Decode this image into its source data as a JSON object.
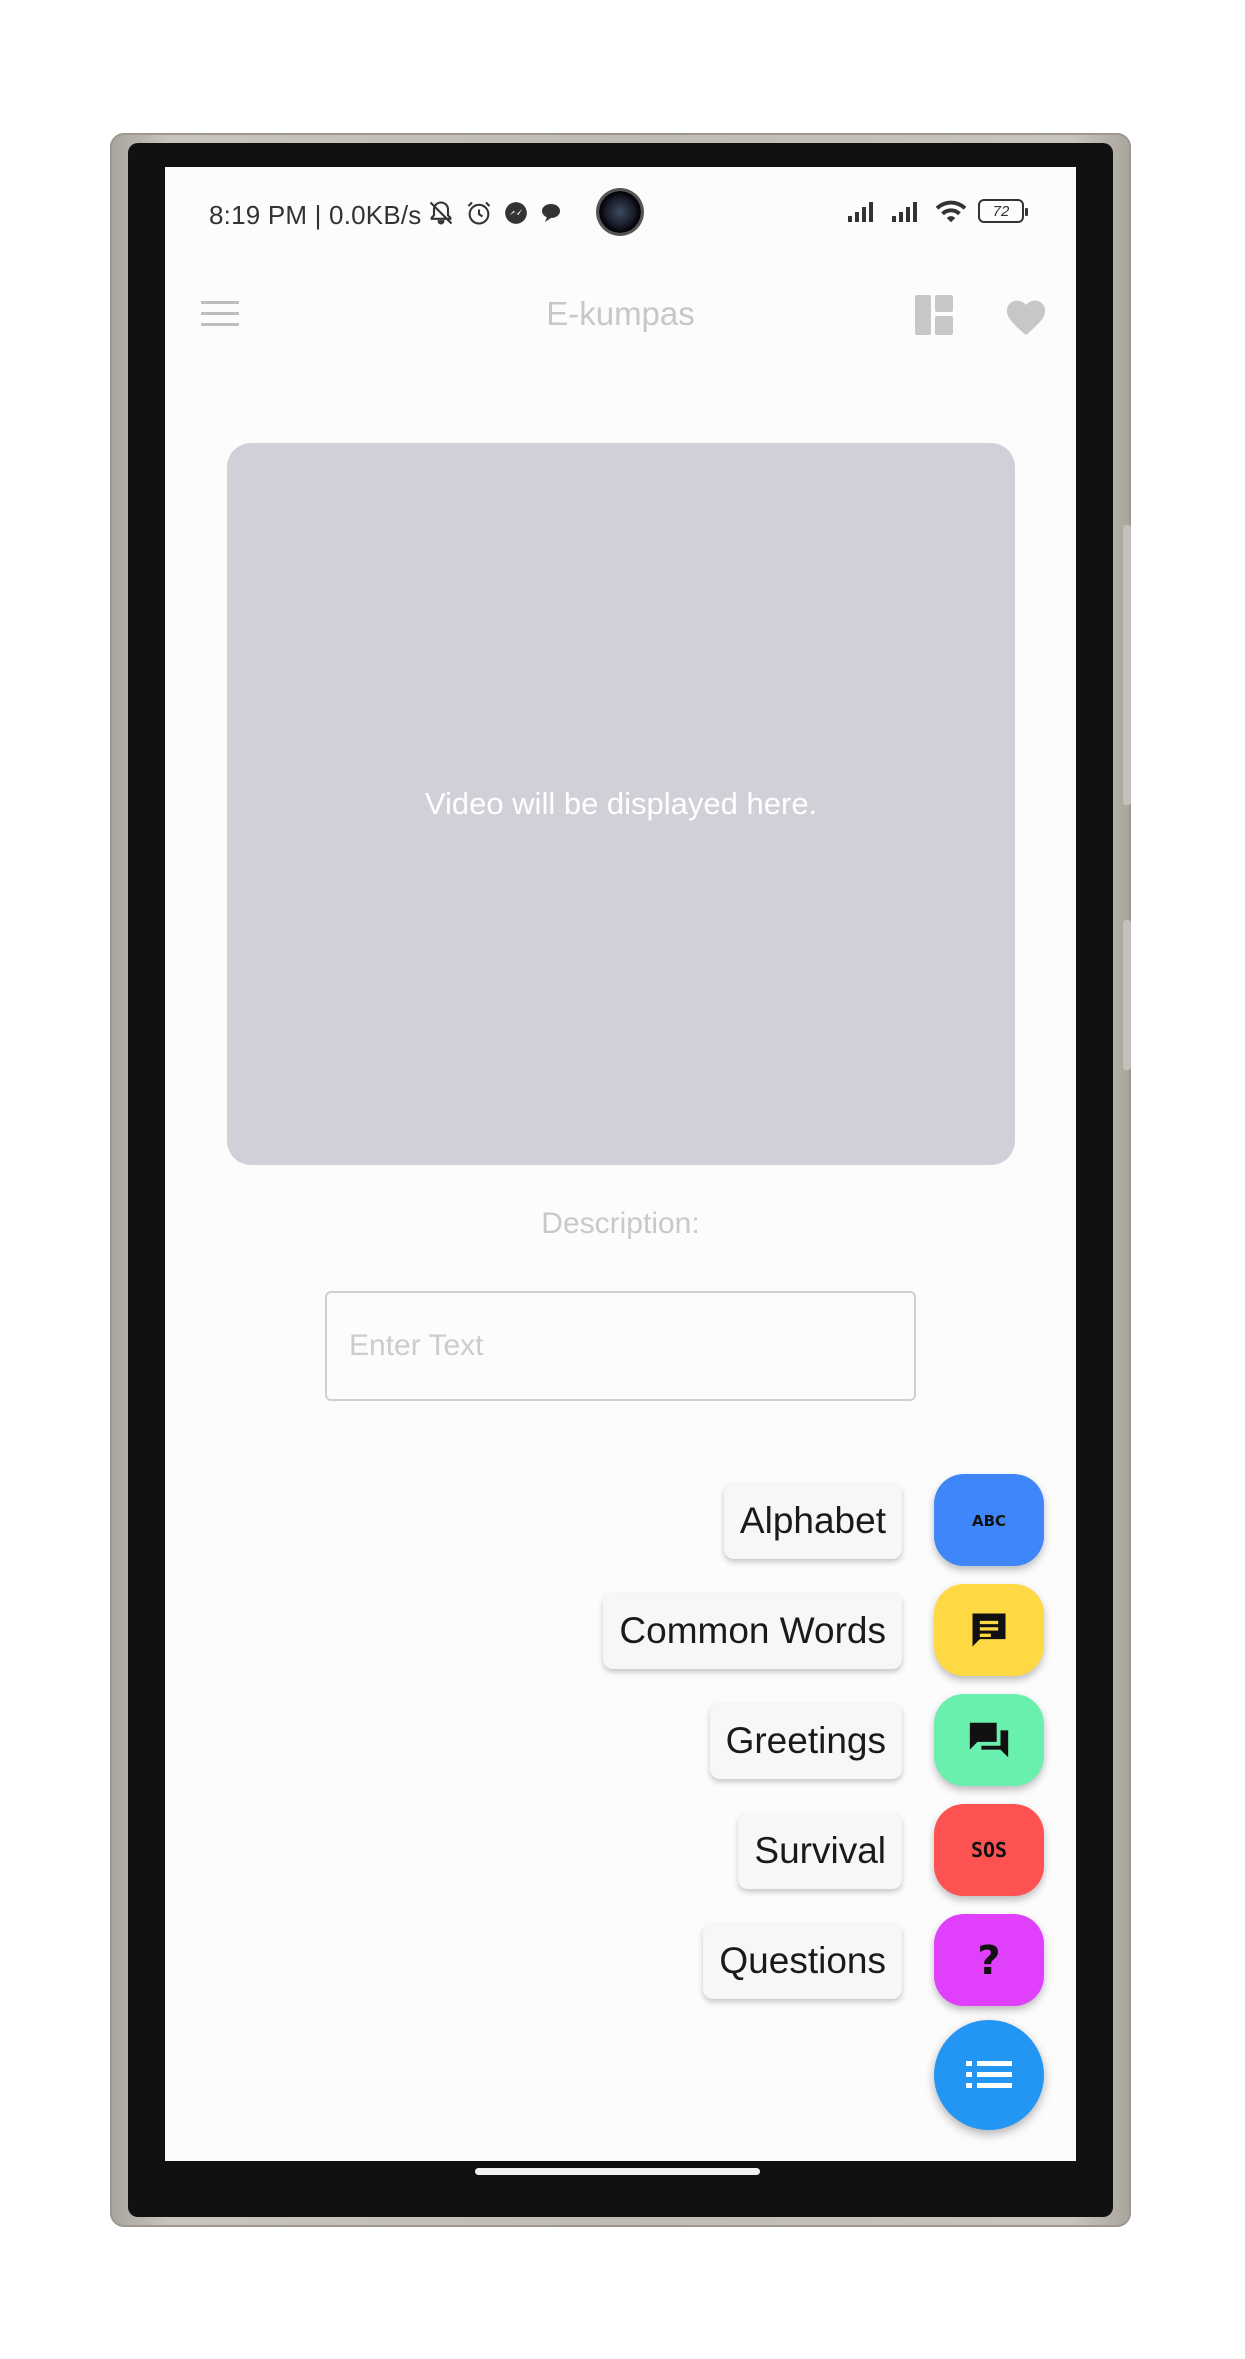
{
  "status_bar": {
    "text": "8:19 PM | 0.0KB/s",
    "battery": "72",
    "left_icons": [
      "bell-off-icon",
      "alarm-icon",
      "messenger-icon",
      "chat-bubble-icon"
    ],
    "right_icons": [
      "signal-icon",
      "signal-icon",
      "wifi-icon",
      "battery-icon"
    ]
  },
  "app_bar": {
    "title": "E-kumpas",
    "menu_icon": "hamburger-menu-icon",
    "layout_icon": "dashboard-layout-icon",
    "favorite_icon": "heart-icon"
  },
  "video": {
    "placeholder_text": "Video will be displayed here."
  },
  "description": {
    "label": "Description:",
    "input_placeholder": "Enter Text",
    "input_value": ""
  },
  "speed_dial": {
    "main_icon": "list-icon",
    "main_color": "#2396f3",
    "actions": [
      {
        "label": "Alphabet",
        "icon": "abc-icon",
        "color": "#3f86fa"
      },
      {
        "label": "Common Words",
        "icon": "chat-text-icon",
        "color": "#ffd944"
      },
      {
        "label": "Greetings",
        "icon": "forum-icon",
        "color": "#69f0ae"
      },
      {
        "label": "Survival",
        "icon": "sos-icon",
        "color": "#fd5252"
      },
      {
        "label": "Questions",
        "icon": "question-mark-icon",
        "color": "#e040fb"
      }
    ]
  }
}
